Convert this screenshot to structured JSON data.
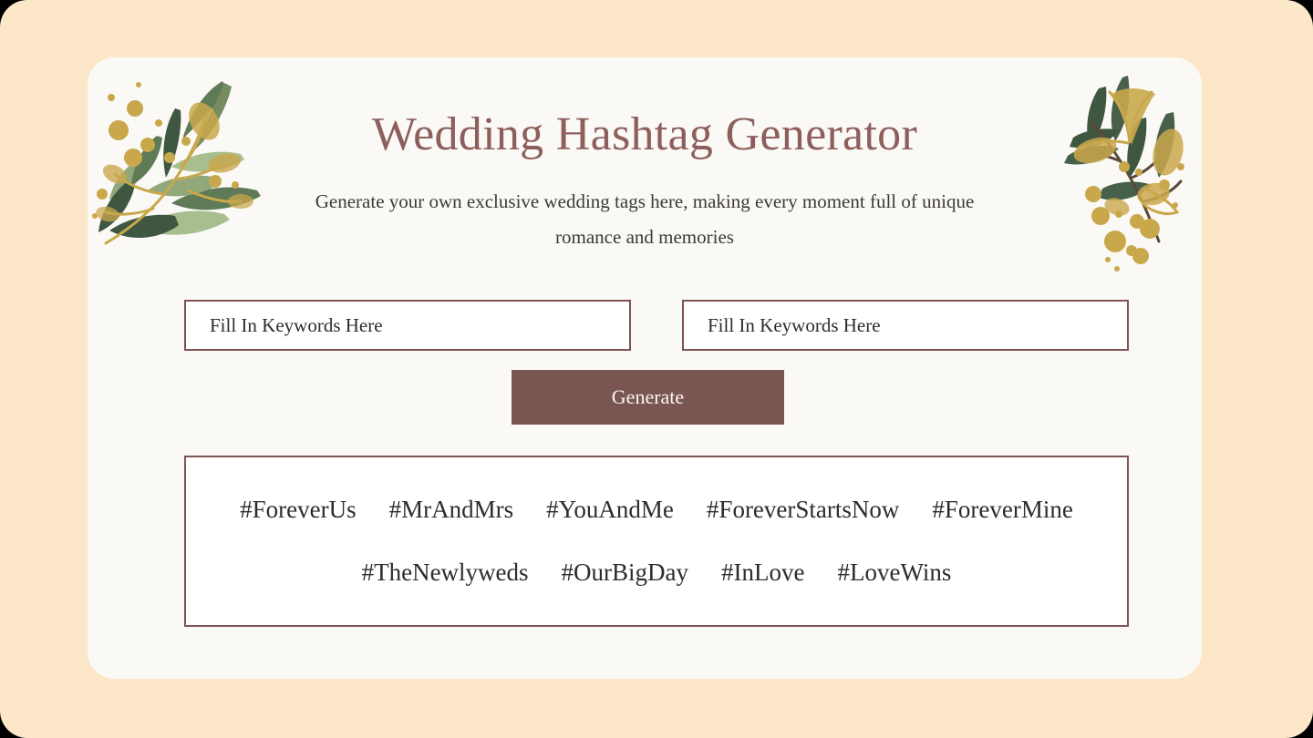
{
  "theme": {
    "page_background": "#FCE8C8",
    "card_background": "#FBF9F6",
    "accent": "#7C5552",
    "title_color": "#8D5F5C",
    "button_background": "#7A5652",
    "button_text_color": "#FBF6F2",
    "text_color": "#2E2C2B",
    "leaf_green_light": "#A9BE8E",
    "leaf_green_mid": "#7E9364",
    "leaf_green_dark": "#3F5741",
    "gold": "#C9A84C"
  },
  "header": {
    "title": "Wedding Hashtag Generator",
    "subtitle": "Generate your own exclusive wedding tags here, making every moment full of unique romance and memories"
  },
  "decorations": {
    "left": "botanical-branch-left",
    "right": "botanical-branch-right"
  },
  "form": {
    "inputs": [
      {
        "name": "keyword-1",
        "placeholder": "Fill In Keywords Here",
        "value": ""
      },
      {
        "name": "keyword-2",
        "placeholder": "Fill In Keywords Here",
        "value": ""
      }
    ],
    "generate_label": "Generate"
  },
  "results": {
    "rows": [
      [
        "#ForeverUs",
        "#MrAndMrs",
        "#YouAndMe",
        "#ForeverStartsNow",
        "#ForeverMine"
      ],
      [
        "#TheNewlyweds",
        "#OurBigDay",
        "#InLove",
        "#LoveWins"
      ]
    ]
  }
}
